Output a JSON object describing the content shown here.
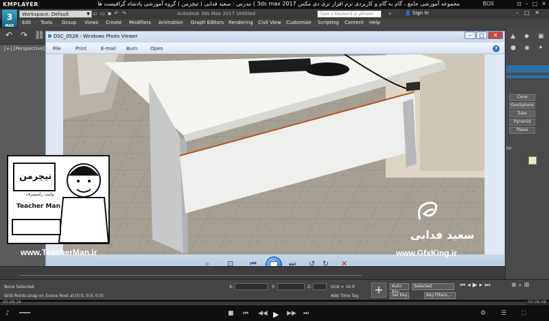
{
  "kmplayer": {
    "logo": "KMPLAYER",
    "title": "مجموعه آموزشی جامع ، گام به گام و کاربردی نرم افزار تری دی مکس 3ds max 2017 )  مدرس : سعید فدایی ( تیچرمن ) گروه آموزشی پادشاه گرافیست ها",
    "box_label": "BOX",
    "time_elapsed": "00:08:26",
    "time_total": "00:08:48",
    "progress": 0.96
  },
  "max": {
    "logo": "3",
    "logo_sub": "MAX",
    "workspace": "Workspace: Default",
    "title": "Autodesk 3ds Max 2017    Untitled",
    "search_placeholder": "Type a keyword or phrase",
    "signin": "Sign In",
    "menu": [
      "Edit",
      "Tools",
      "Group",
      "Views",
      "Create",
      "Modifiers",
      "Animation",
      "Graph Editors",
      "Rendering",
      "Civil View",
      "Customize",
      "Scripting",
      "Content",
      "Help"
    ],
    "viewport_label": "[+] [Perspective]",
    "command_buttons": [
      "Cone",
      "GeoSphere",
      "Tube",
      "Pyramid",
      "Plane"
    ],
    "command_label": "lor",
    "status": {
      "none_selected": "None Selected",
      "grid_points": "Grid Points snap on Scene Root at [0.0, 0.0, 0.0]",
      "x_label": "X:",
      "y_label": "Y:",
      "z_label": "Z:",
      "grid": "Grid = 10.0",
      "add_time_tag": "Add Time Tag",
      "auto_key": "Auto Key",
      "set_key": "Set Key",
      "selected": "Selected",
      "key_filters": "Key Filters..."
    }
  },
  "photo_viewer": {
    "title": "DSC_0528 - Windows Photo Viewer",
    "menu": [
      "File",
      "Print",
      "E-mail",
      "Burn",
      "Open"
    ],
    "help": "?"
  },
  "watermark": {
    "site1": "www.TeacherMan.ir",
    "site2": "www.GfxKing.ir",
    "name": "سعید فدایی",
    "logo_text": "Teacher Man",
    "logo_fa": "تیچرمن",
    "logo_sub": "وانیت رامیسرف"
  },
  "colors": {
    "max_bg": "#424242",
    "viewer_chrome": "#c8d8eb",
    "accent": "#2e6fa8"
  }
}
